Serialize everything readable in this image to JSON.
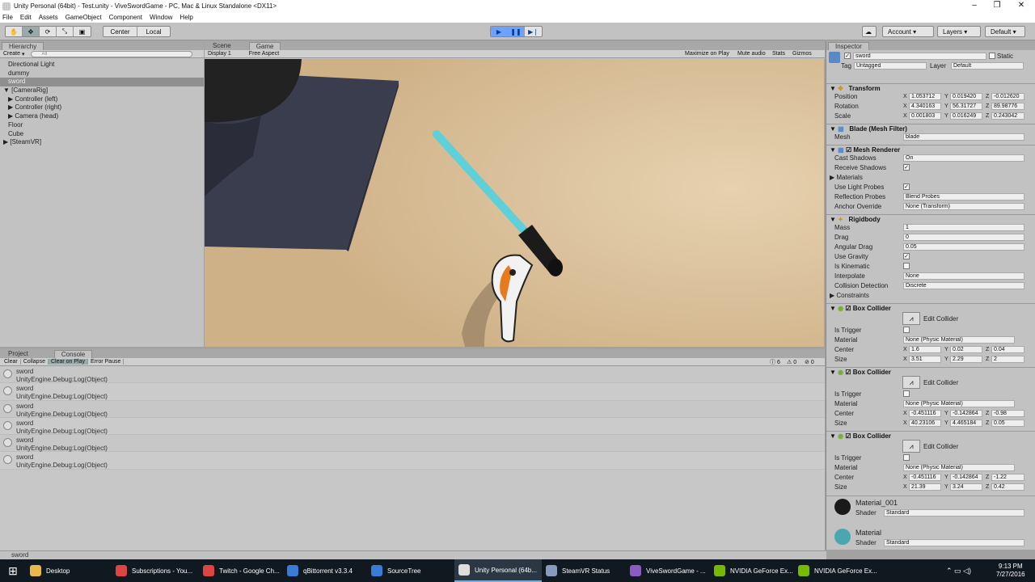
{
  "window": {
    "title": "Unity Personal (64bit) - Test.unity - ViveSwordGame - PC, Mac & Linux Standalone <DX11>",
    "controls": [
      "–",
      "❐",
      "✕"
    ]
  },
  "menu": [
    "File",
    "Edit",
    "Assets",
    "GameObject",
    "Component",
    "Window",
    "Help"
  ],
  "toolbar": {
    "center_label": "Center",
    "local_label": "Local",
    "account_label": "Account",
    "layers_label": "Layers",
    "layout_label": "Default"
  },
  "hierarchy": {
    "tab": "Hierarchy",
    "create": "Create",
    "search_placeholder": "All",
    "items": [
      {
        "label": "Directional Light",
        "indent": 0
      },
      {
        "label": "dummy",
        "indent": 0
      },
      {
        "label": "sword",
        "indent": 0,
        "selected": true
      },
      {
        "label": "▼ [CameraRig]",
        "indent": 0
      },
      {
        "label": "▶ Controller (left)",
        "indent": 1
      },
      {
        "label": "▶ Controller (right)",
        "indent": 1
      },
      {
        "label": "▶ Camera (head)",
        "indent": 1
      },
      {
        "label": "Floor",
        "indent": 0
      },
      {
        "label": "Cube",
        "indent": 0
      },
      {
        "label": "▶ [SteamVR]",
        "indent": 0
      }
    ]
  },
  "scene_tabs": {
    "scene": "Scene",
    "game": "Game"
  },
  "game_bar": {
    "display": "Display 1",
    "aspect": "Free Aspect",
    "maximize": "Maximize on Play",
    "mute": "Mute audio",
    "stats": "Stats",
    "gizmos": "Gizmos"
  },
  "console": {
    "project_tab": "Project",
    "console_tab": "Console",
    "buttons": [
      "Clear",
      "Collapse",
      "Clear on Play",
      "Error Pause"
    ],
    "counts": [
      "6",
      "0",
      "0"
    ],
    "rows": [
      {
        "title": "sword",
        "detail": "UnityEngine.Debug:Log(Object)"
      },
      {
        "title": "sword",
        "detail": "UnityEngine.Debug:Log(Object)"
      },
      {
        "title": "sword",
        "detail": "UnityEngine.Debug:Log(Object)"
      },
      {
        "title": "sword",
        "detail": "UnityEngine.Debug:Log(Object)"
      },
      {
        "title": "sword",
        "detail": "UnityEngine.Debug:Log(Object)"
      },
      {
        "title": "sword",
        "detail": "UnityEngine.Debug:Log(Object)"
      }
    ]
  },
  "status_text": "sword",
  "inspector": {
    "tab": "Inspector",
    "name": "sword",
    "static": "Static",
    "tag_label": "Tag",
    "tag": "Untagged",
    "layer_label": "Layer",
    "layer": "Default",
    "transform": {
      "title": "Transform",
      "position": {
        "label": "Position",
        "x": "1.053712",
        "y": "0.019420",
        "z": "-0.012620"
      },
      "rotation": {
        "label": "Rotation",
        "x": "4.340163",
        "y": "56.31727",
        "z": "89.98776"
      },
      "scale": {
        "label": "Scale",
        "x": "0.001803",
        "y": "0.016249",
        "z": "0.243042"
      }
    },
    "mesh_filter": {
      "title": "Blade (Mesh Filter)",
      "mesh_label": "Mesh",
      "mesh": "blade"
    },
    "mesh_renderer": {
      "title": "Mesh Renderer",
      "cast_shadows": "Cast Shadows",
      "cast_value": "On",
      "receive_shadows": "Receive Shadows",
      "materials": "Materials",
      "light_probes": "Use Light Probes",
      "reflection": "Reflection Probes",
      "reflection_value": "Blend Probes",
      "anchor": "Anchor Override",
      "anchor_value": "None (Transform)"
    },
    "rigidbody": {
      "title": "Rigidbody",
      "mass": "Mass",
      "mass_value": "1",
      "drag": "Drag",
      "drag_value": "0",
      "angular": "Angular Drag",
      "angular_value": "0.05",
      "gravity": "Use Gravity",
      "kinematic": "Is Kinematic",
      "interpolate": "Interpolate",
      "interpolate_value": "None",
      "collision": "Collision Detection",
      "collision_value": "Discrete",
      "constraints": "Constraints"
    },
    "colliders": [
      {
        "title": "Box Collider",
        "edit": "Edit Collider",
        "trigger": "Is Trigger",
        "material": "Material",
        "material_value": "None (Physic Material)",
        "center": "Center",
        "cx": "1.6",
        "cy": "0.02",
        "cz": "0.04",
        "size": "Size",
        "sx": "3.51",
        "sy": "2.29",
        "sz": "2"
      },
      {
        "title": "Box Collider",
        "edit": "Edit Collider",
        "trigger": "Is Trigger",
        "material": "Material",
        "material_value": "None (Physic Material)",
        "center": "Center",
        "cx": "-0.451116",
        "cy": "-0.142864",
        "cz": "-0.98",
        "size": "Size",
        "sx": "40.23106",
        "sy": "4.465184",
        "sz": "0.05"
      },
      {
        "title": "Box Collider",
        "edit": "Edit Collider",
        "trigger": "Is Trigger",
        "material": "Material",
        "material_value": "None (Physic Material)",
        "center": "Center",
        "cx": "-0.451116",
        "cy": "-0.142864",
        "cz": "-1.22",
        "size": "Size",
        "sx": "21.39",
        "sy": "3.24",
        "sz": "0.42"
      }
    ],
    "materials": [
      {
        "name": "Material_001",
        "shader_label": "Shader",
        "shader": "Standard",
        "color": "#1a1a1a"
      },
      {
        "name": "Material",
        "shader_label": "Shader",
        "shader": "Standard",
        "color": "#4aa6b0"
      }
    ]
  },
  "taskbar": {
    "items": [
      {
        "label": "Desktop",
        "color": "#e8b84a"
      },
      {
        "label": "Subscriptions - You...",
        "color": "#d44"
      },
      {
        "label": "Twitch - Google Ch...",
        "color": "#d44"
      },
      {
        "label": "qBittorrent v3.3.4",
        "color": "#3a7bd5"
      },
      {
        "label": "SourceTree",
        "color": "#3a7bd5"
      },
      {
        "label": "Unity Personal (64b...",
        "color": "#ddd"
      },
      {
        "label": "SteamVR Status",
        "color": "#89b"
      },
      {
        "label": "ViveSwordGame - ...",
        "color": "#8a5cc2"
      },
      {
        "label": "NVIDIA GeForce Ex...",
        "color": "#76b900"
      },
      {
        "label": "NVIDIA GeForce Ex...",
        "color": "#76b900"
      }
    ],
    "time": "9:13 PM",
    "date": "7/27/2016"
  },
  "colors": {
    "accent": "#6da3ff",
    "blade": "#5fd0d8",
    "floor": "#d7bb92"
  }
}
